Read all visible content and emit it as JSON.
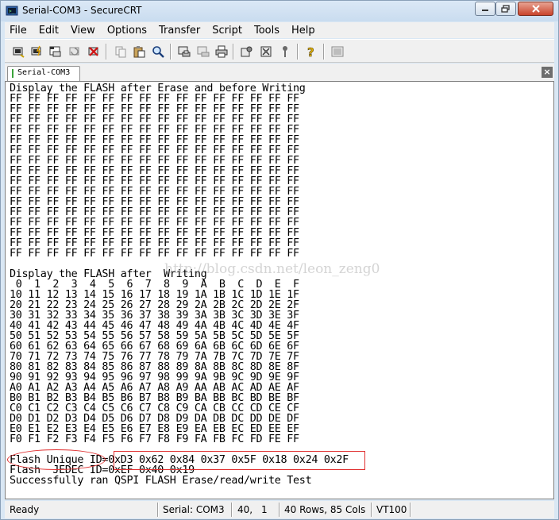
{
  "window": {
    "title": "Serial-COM3 - SecureCRT"
  },
  "menu": [
    "File",
    "Edit",
    "View",
    "Options",
    "Transfer",
    "Script",
    "Tools",
    "Help"
  ],
  "toolbar": {
    "icons": [
      "connect-icon",
      "quick-connect-icon",
      "connect-tab-icon",
      "reconnect-icon",
      "disconnect-icon",
      "copy-icon",
      "paste-icon",
      "find-icon",
      "print-screen-icon",
      "print-selection-icon",
      "print-icon",
      "session-options-icon",
      "global-options-icon",
      "keymap-icon",
      "help-icon",
      "sftp-icon"
    ]
  },
  "tab": {
    "label": "Serial-COM3"
  },
  "terminal": {
    "lines": [
      "Display the FLASH after Erase and before Writing",
      "FF FF FF FF FF FF FF FF FF FF FF FF FF FF FF FF",
      "FF FF FF FF FF FF FF FF FF FF FF FF FF FF FF FF",
      "FF FF FF FF FF FF FF FF FF FF FF FF FF FF FF FF",
      "FF FF FF FF FF FF FF FF FF FF FF FF FF FF FF FF",
      "FF FF FF FF FF FF FF FF FF FF FF FF FF FF FF FF",
      "FF FF FF FF FF FF FF FF FF FF FF FF FF FF FF FF",
      "FF FF FF FF FF FF FF FF FF FF FF FF FF FF FF FF",
      "FF FF FF FF FF FF FF FF FF FF FF FF FF FF FF FF",
      "FF FF FF FF FF FF FF FF FF FF FF FF FF FF FF FF",
      "FF FF FF FF FF FF FF FF FF FF FF FF FF FF FF FF",
      "FF FF FF FF FF FF FF FF FF FF FF FF FF FF FF FF",
      "FF FF FF FF FF FF FF FF FF FF FF FF FF FF FF FF",
      "FF FF FF FF FF FF FF FF FF FF FF FF FF FF FF FF",
      "FF FF FF FF FF FF FF FF FF FF FF FF FF FF FF FF",
      "FF FF FF FF FF FF FF FF FF FF FF FF FF FF FF FF",
      "FF FF FF FF FF FF FF FF FF FF FF FF FF FF FF FF",
      "",
      "Display the FLASH after  Writing",
      " 0  1  2  3  4  5  6  7  8  9  A  B  C  D  E  F",
      "10 11 12 13 14 15 16 17 18 19 1A 1B 1C 1D 1E 1F",
      "20 21 22 23 24 25 26 27 28 29 2A 2B 2C 2D 2E 2F",
      "30 31 32 33 34 35 36 37 38 39 3A 3B 3C 3D 3E 3F",
      "40 41 42 43 44 45 46 47 48 49 4A 4B 4C 4D 4E 4F",
      "50 51 52 53 54 55 56 57 58 59 5A 5B 5C 5D 5E 5F",
      "60 61 62 63 64 65 66 67 68 69 6A 6B 6C 6D 6E 6F",
      "70 71 72 73 74 75 76 77 78 79 7A 7B 7C 7D 7E 7F",
      "80 81 82 83 84 85 86 87 88 89 8A 8B 8C 8D 8E 8F",
      "90 91 92 93 94 95 96 97 98 99 9A 9B 9C 9D 9E 9F",
      "A0 A1 A2 A3 A4 A5 A6 A7 A8 A9 AA AB AC AD AE AF",
      "B0 B1 B2 B3 B4 B5 B6 B7 B8 B9 BA BB BC BD BE BF",
      "C0 C1 C2 C3 C4 C5 C6 C7 C8 C9 CA CB CC CD CE CF",
      "D0 D1 D2 D3 D4 D5 D6 D7 D8 D9 DA DB DC DD DE DF",
      "E0 E1 E2 E3 E4 E5 E6 E7 E8 E9 EA EB EC ED EE EF",
      "F0 F1 F2 F3 F4 F5 F6 F7 F8 F9 FA FB FC FD FE FF",
      "",
      "Flash Unique ID=0xD3 0x62 0x84 0x37 0x5F 0x18 0x24 0x2F",
      "Flash  JEDEC ID=0xEF 0x40 0x19",
      "Successfully ran QSPI FLASH Erase/read/write Test"
    ],
    "watermark": "http://blog.csdn.net/leon_zeng0"
  },
  "status": {
    "ready": "Ready",
    "connection": "Serial: COM3",
    "row": "40,",
    "col": "1",
    "size": "40 Rows,  85 Cols",
    "emulation": "VT100"
  },
  "colors": {
    "annotation": "#e03030",
    "titlebar": "#d9e7f4",
    "chrome": "#f0f0f0"
  }
}
